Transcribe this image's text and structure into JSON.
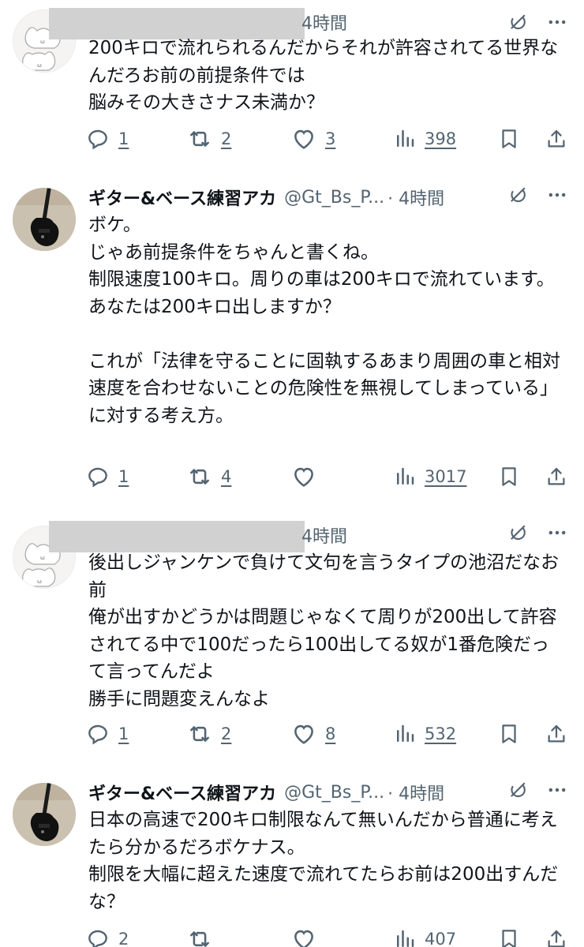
{
  "tweets": [
    {
      "author_name": "",
      "author_handle": "",
      "time": "4時間",
      "body": "200キロで流れられるんだからそれが許容されてる世界なんだろお前の前提条件では\n脳みその大きさナス未満か？",
      "stats": {
        "replies": "1",
        "retweets": "2",
        "likes": "3",
        "views": "398"
      }
    },
    {
      "author_name": "ギター&ベース練習アカ",
      "author_handle": "@Gt_Bs_P...",
      "time": "· 4時間",
      "body": "ボケ。\nじゃあ前提条件をちゃんと書くね。\n制限速度100キロ。周りの車は200キロで流れています。\nあなたは200キロ出しますか？\n\nこれが「法律を守ることに固執するあまり周囲の車と相対速度を合わせないことの危険性を無視してしまっている」に対する考え方。",
      "stats": {
        "replies": "1",
        "retweets": "4",
        "likes": "",
        "views": "3017"
      }
    },
    {
      "author_name": "",
      "author_handle": "",
      "time": "4時間",
      "body": "後出しジャンケンで負けて文句を言うタイプの池沼だなお前\n俺が出すかどうかは問題じゃなくて周りが200出して許容されてる中で100だったら100出してる奴が1番危険だって言ってんだよ\n勝手に問題変えんなよ",
      "stats": {
        "replies": "1",
        "retweets": "2",
        "likes": "8",
        "views": "532"
      }
    },
    {
      "author_name": "ギター&ベース練習アカ",
      "author_handle": "@Gt_Bs_P...",
      "time": "· 4時間",
      "body": "日本の高速で200キロ制限なんて無いんだから普通に考えたら分かるだろボケナス。\n制限を大幅に超えた速度で流れてたらお前は200出すんだな？",
      "stats": {
        "replies": "2",
        "retweets": "",
        "likes": "",
        "views": "407"
      }
    }
  ],
  "icons": {
    "reply": "reply-icon",
    "retweet": "retweet-icon",
    "like": "heart-icon",
    "views": "views-chart-icon",
    "bookmark": "bookmark-icon",
    "share": "share-icon",
    "grok": "grok-icon",
    "more": "more-icon"
  },
  "colors": {
    "text": "#0f1419",
    "secondary": "#536471",
    "redaction": "#d1d1d1"
  }
}
